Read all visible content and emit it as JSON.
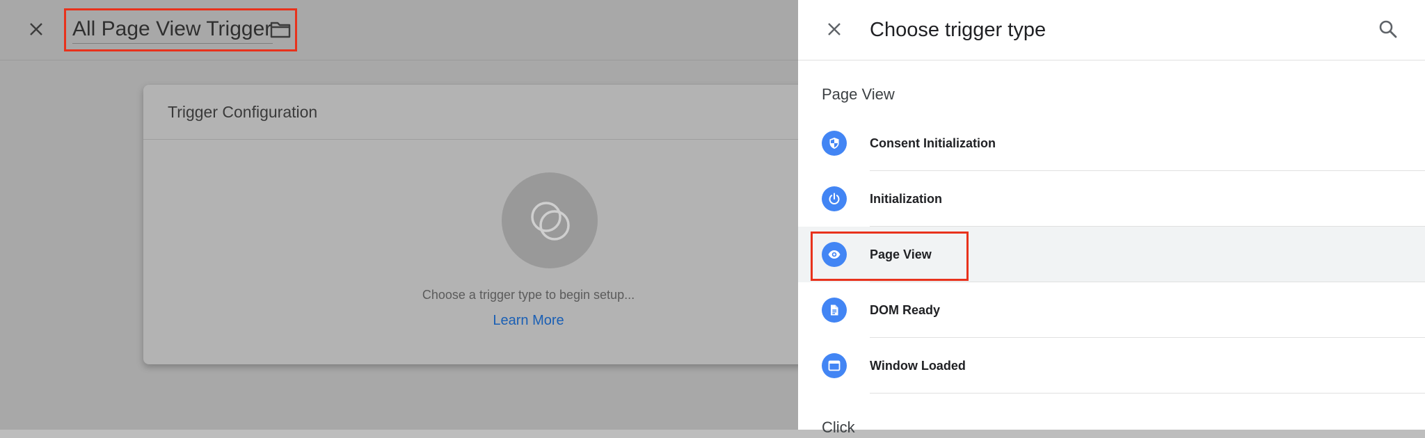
{
  "editor": {
    "trigger_name": "All Page View Trigger",
    "config_card": {
      "title": "Trigger Configuration",
      "hint": "Choose a trigger type to begin setup...",
      "learn_more": "Learn More"
    }
  },
  "panel": {
    "title": "Choose trigger type",
    "sections": [
      {
        "label": "Page View",
        "items": [
          {
            "label": "Consent Initialization",
            "icon": "shield-icon"
          },
          {
            "label": "Initialization",
            "icon": "power-icon"
          },
          {
            "label": "Page View",
            "icon": "eye-icon",
            "selected": true
          },
          {
            "label": "DOM Ready",
            "icon": "document-icon"
          },
          {
            "label": "Window Loaded",
            "icon": "window-icon"
          }
        ]
      },
      {
        "label": "Click",
        "items": []
      }
    ]
  },
  "colors": {
    "accent": "#4285f4",
    "highlight": "#e8321c",
    "link": "#1a5fb4"
  }
}
